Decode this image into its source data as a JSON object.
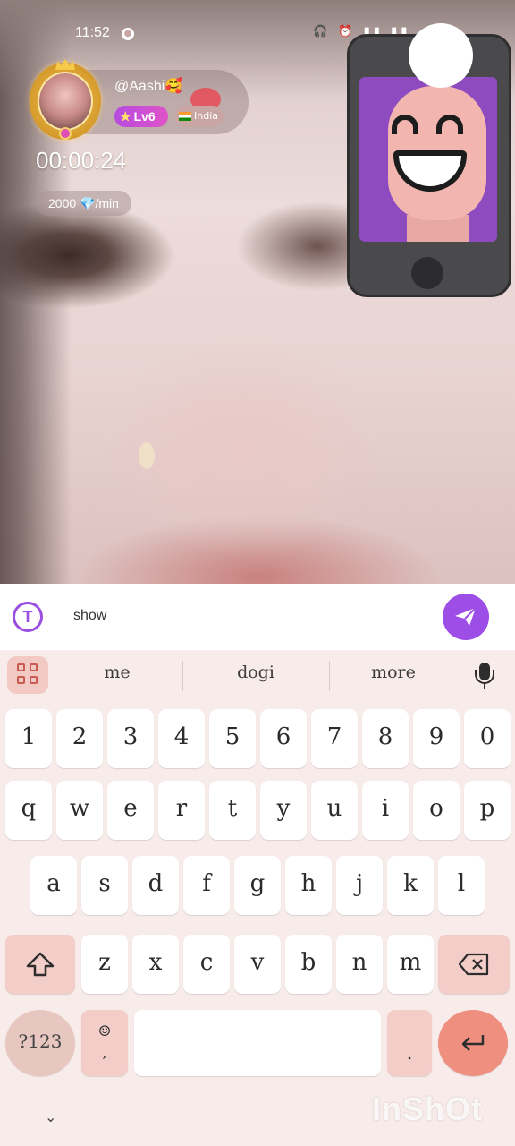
{
  "status_bar": {
    "time": "11:52",
    "icons": "🎧 ⏰ ▮▮ ▮▮"
  },
  "profile": {
    "username": "@Aashi🥰",
    "level": "Lv6",
    "country": "India"
  },
  "call": {
    "timer": "00:00:24",
    "rate_value": "2000",
    "rate_icon": "💎",
    "rate_unit": "/min"
  },
  "input": {
    "value": "show",
    "t_icon_label": "T"
  },
  "keyboard": {
    "suggestions": [
      "me",
      "dogi",
      "more"
    ],
    "row_numbers": [
      "1",
      "2",
      "3",
      "4",
      "5",
      "6",
      "7",
      "8",
      "9",
      "0"
    ],
    "row_top": [
      "q",
      "w",
      "e",
      "r",
      "t",
      "y",
      "u",
      "i",
      "o",
      "p"
    ],
    "row_home": [
      "a",
      "s",
      "d",
      "f",
      "g",
      "h",
      "j",
      "k",
      "l"
    ],
    "row_bottom": [
      "z",
      "x",
      "c",
      "v",
      "b",
      "n",
      "m"
    ],
    "symbols_label": "?123",
    "emoji_label": "☺",
    "period_label": ".",
    "comma_label": ","
  },
  "watermark": "InShOt",
  "colors": {
    "accent": "#9d4ee6",
    "enter": "#ef8f80",
    "keyboard_bg": "#f8ecea",
    "func_key": "#f3cdc7"
  }
}
